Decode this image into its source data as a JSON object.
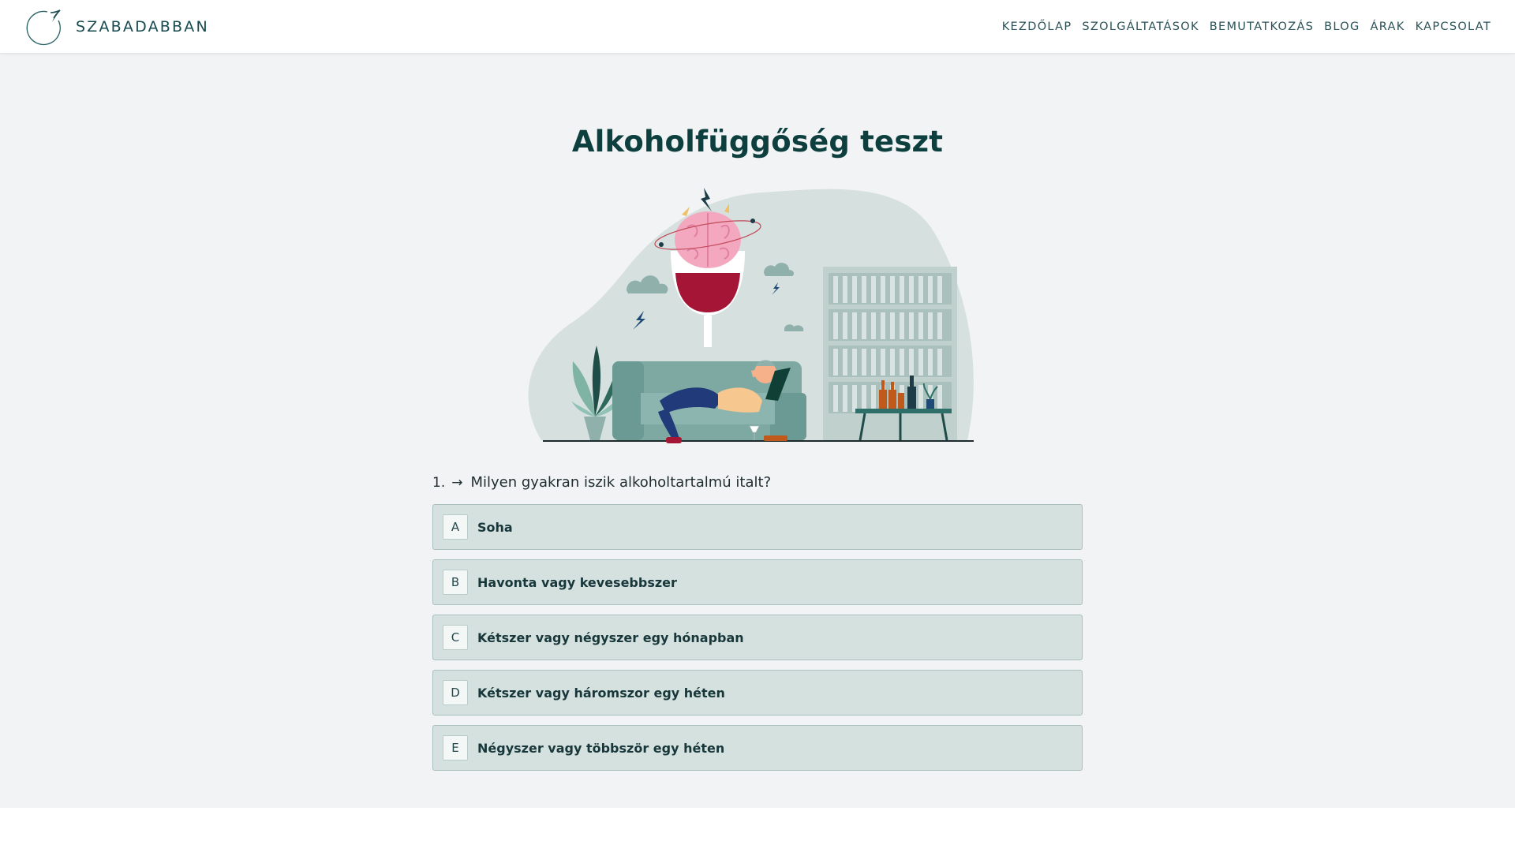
{
  "brand": {
    "name": "SZABADABBAN",
    "logo_icon": "swoosh-circle-logo"
  },
  "nav": {
    "items": [
      {
        "label": "KEZDŐLAP"
      },
      {
        "label": "SZOLGÁLTATÁSOK"
      },
      {
        "label": "BEMUTATKOZÁS"
      },
      {
        "label": "BLOG"
      },
      {
        "label": "ÁRAK"
      },
      {
        "label": "KAPCSOLAT"
      }
    ]
  },
  "page": {
    "title": "Alkoholfüggőség teszt",
    "illustration_icon": "drunk-man-on-sofa-illustration"
  },
  "question": {
    "number": "1",
    "arrow": "→",
    "text": "Milyen gyakran iszik alkoholtartalmú italt?"
  },
  "answers": [
    {
      "key": "A",
      "label": "Soha"
    },
    {
      "key": "B",
      "label": "Havonta vagy kevesebbszer"
    },
    {
      "key": "C",
      "label": "Kétszer vagy négyszer egy hónapban"
    },
    {
      "key": "D",
      "label": "Kétszer vagy háromszor egy héten"
    },
    {
      "key": "E",
      "label": "Négyszer vagy többször egy héten"
    }
  ],
  "colors": {
    "primary": "#0d3f3e",
    "answer_bg": "#d4e1df",
    "page_bg": "#f2f3f5",
    "wine": "#a51535"
  }
}
